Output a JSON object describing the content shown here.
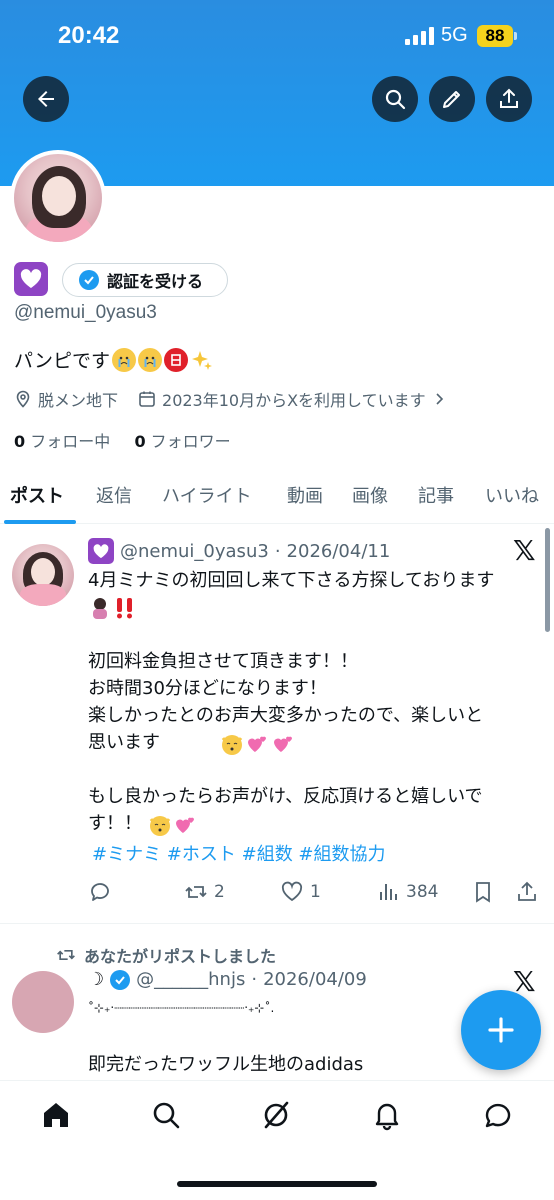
{
  "status_bar": {
    "time": "20:42",
    "network": "5G",
    "battery": "88"
  },
  "profile": {
    "verify_button": "認証を受ける",
    "handle": "@nemui_0yasu3",
    "bio_text": "パンピです",
    "location": "脱メン地下",
    "joined": "2023年10月からXを利用しています",
    "following_count": "0",
    "following_label": "フォロー中",
    "followers_count": "0",
    "followers_label": "フォロワー"
  },
  "tabs": [
    {
      "label": "ポスト"
    },
    {
      "label": "返信"
    },
    {
      "label": "ハイライト"
    },
    {
      "label": "動画"
    },
    {
      "label": "画像"
    },
    {
      "label": "記事"
    },
    {
      "label": "いいね"
    }
  ],
  "posts": [
    {
      "handle": "@nemui_0yasu3",
      "separator": "·",
      "date": "2026/04/11",
      "line1": "4月ミナミの初回回し来て下さる方探しております",
      "line2": "初回料金負担させて頂きます！！\nお時間30分ほどになります！\n楽しかったとのお声大変多かったので、楽しいと\n思います",
      "line3": "もし良かったらお声がけ、反応頂けると嬉しいで\nす！！",
      "tags": "#ミナミ #ホスト #組数 #組数協力",
      "retweets": "2",
      "likes": "1",
      "views": "384"
    },
    {
      "repost_label": "あなたがリポストしました",
      "name": "☽",
      "handle": "@______hnjs",
      "separator": "·",
      "date": "2026/04/09",
      "decor": "˚⊹₊‧┈┈┈┈┈┈┈┈┈┈┈┈┈┈┈┈┈┈‧₊⊹˚.",
      "line1": "即完だったワッフル生地のadidas"
    }
  ],
  "icons": {
    "back": "arrow-left-icon",
    "search": "search-icon",
    "edit": "pencil-icon",
    "share": "share-icon",
    "accent": "#1d9bf0"
  }
}
